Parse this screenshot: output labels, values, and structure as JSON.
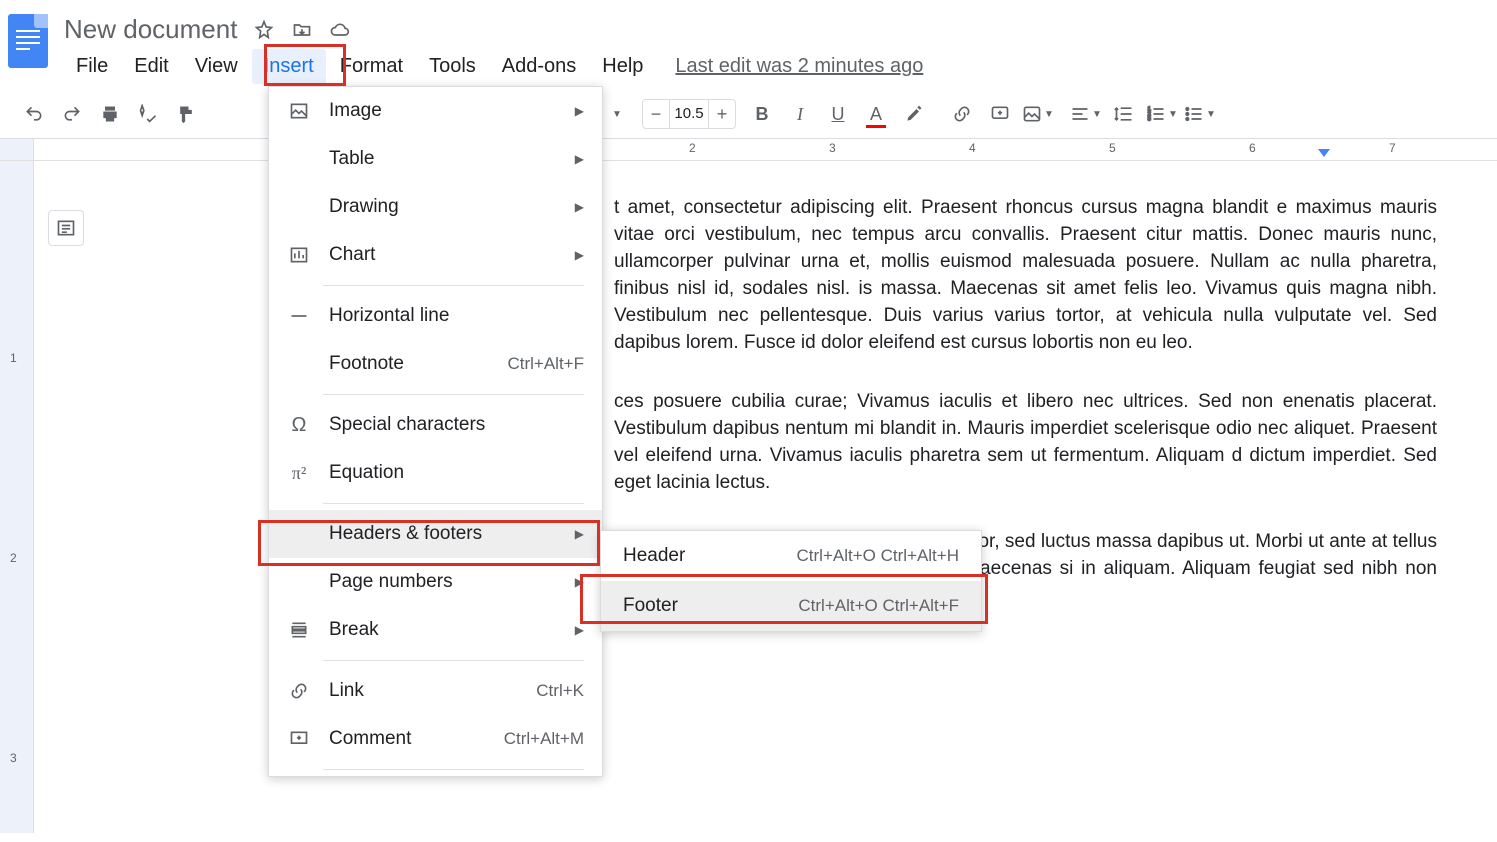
{
  "doc": {
    "title": "New document"
  },
  "menubar": {
    "items": [
      "File",
      "Edit",
      "View",
      "Insert",
      "Format",
      "Tools",
      "Add-ons",
      "Help"
    ],
    "active_index": 3,
    "last_edit": "Last edit was 2 minutes ago"
  },
  "toolbar": {
    "font_size": "10.5"
  },
  "ruler": {
    "ticks": [
      "2",
      "3",
      "4",
      "5",
      "6",
      "7"
    ]
  },
  "vruler": {
    "ticks": [
      "1",
      "2",
      "3"
    ]
  },
  "insert_menu": {
    "items": [
      {
        "icon": "image",
        "label": "Image",
        "submenu": true
      },
      {
        "icon": "table",
        "label": "Table",
        "submenu": true
      },
      {
        "icon": "drawing",
        "label": "Drawing",
        "submenu": true
      },
      {
        "icon": "chart",
        "label": "Chart",
        "submenu": true
      },
      {
        "divider": true
      },
      {
        "icon": "hr",
        "label": "Horizontal line"
      },
      {
        "icon": "",
        "label": "Footnote",
        "shortcut": "Ctrl+Alt+F"
      },
      {
        "divider": true
      },
      {
        "icon": "omega",
        "label": "Special characters"
      },
      {
        "icon": "pi",
        "label": "Equation"
      },
      {
        "divider": true
      },
      {
        "icon": "",
        "label": "Headers & footers",
        "submenu": true,
        "hovered": true
      },
      {
        "icon": "",
        "label": "Page numbers",
        "submenu": true
      },
      {
        "icon": "break",
        "label": "Break",
        "submenu": true
      },
      {
        "divider": true
      },
      {
        "icon": "link",
        "label": "Link",
        "shortcut": "Ctrl+K"
      },
      {
        "icon": "comment",
        "label": "Comment",
        "shortcut": "Ctrl+Alt+M"
      },
      {
        "divider": true
      }
    ]
  },
  "hf_submenu": {
    "items": [
      {
        "label": "Header",
        "shortcut": "Ctrl+Alt+O Ctrl+Alt+H"
      },
      {
        "label": "Footer",
        "shortcut": "Ctrl+Alt+O Ctrl+Alt+F",
        "hovered": true
      }
    ]
  },
  "body_text": {
    "p1": "t amet, consectetur adipiscing elit. Praesent rhoncus cursus magna blandit e maximus mauris vitae orci vestibulum, nec tempus arcu convallis. Praesent citur mattis. Donec mauris nunc, ullamcorper pulvinar urna et, mollis euismod malesuada posuere. Nullam ac nulla pharetra, finibus nisl id, sodales nisl. is massa. Maecenas sit amet felis leo. Vivamus quis magna nibh. Vestibulum nec pellentesque. Duis varius varius tortor, at vehicula nulla vulputate vel. Sed dapibus lorem. Fusce id dolor eleifend est cursus lobortis non eu leo.",
    "p2": "ces posuere cubilia curae; Vivamus iaculis et libero nec ultrices. Sed non enenatis placerat. Vestibulum dapibus nentum mi blandit in. Mauris imperdiet scelerisque odio nec aliquet. Praesent vel eleifend urna. Vivamus iaculis pharetra sem ut fermentum. Aliquam d dictum imperdiet. Sed eget lacinia lectus.",
    "p3": "m augue. Praesent malesuada vehicula dolor, sed luctus massa dapibus ut. Morbi ut ante at tellus consectetur egestas sagittis vel magna. Maecenas si in aliquam. Aliquam feugiat sed nibh non rutrum. Nam egestas sollicitudin"
  }
}
